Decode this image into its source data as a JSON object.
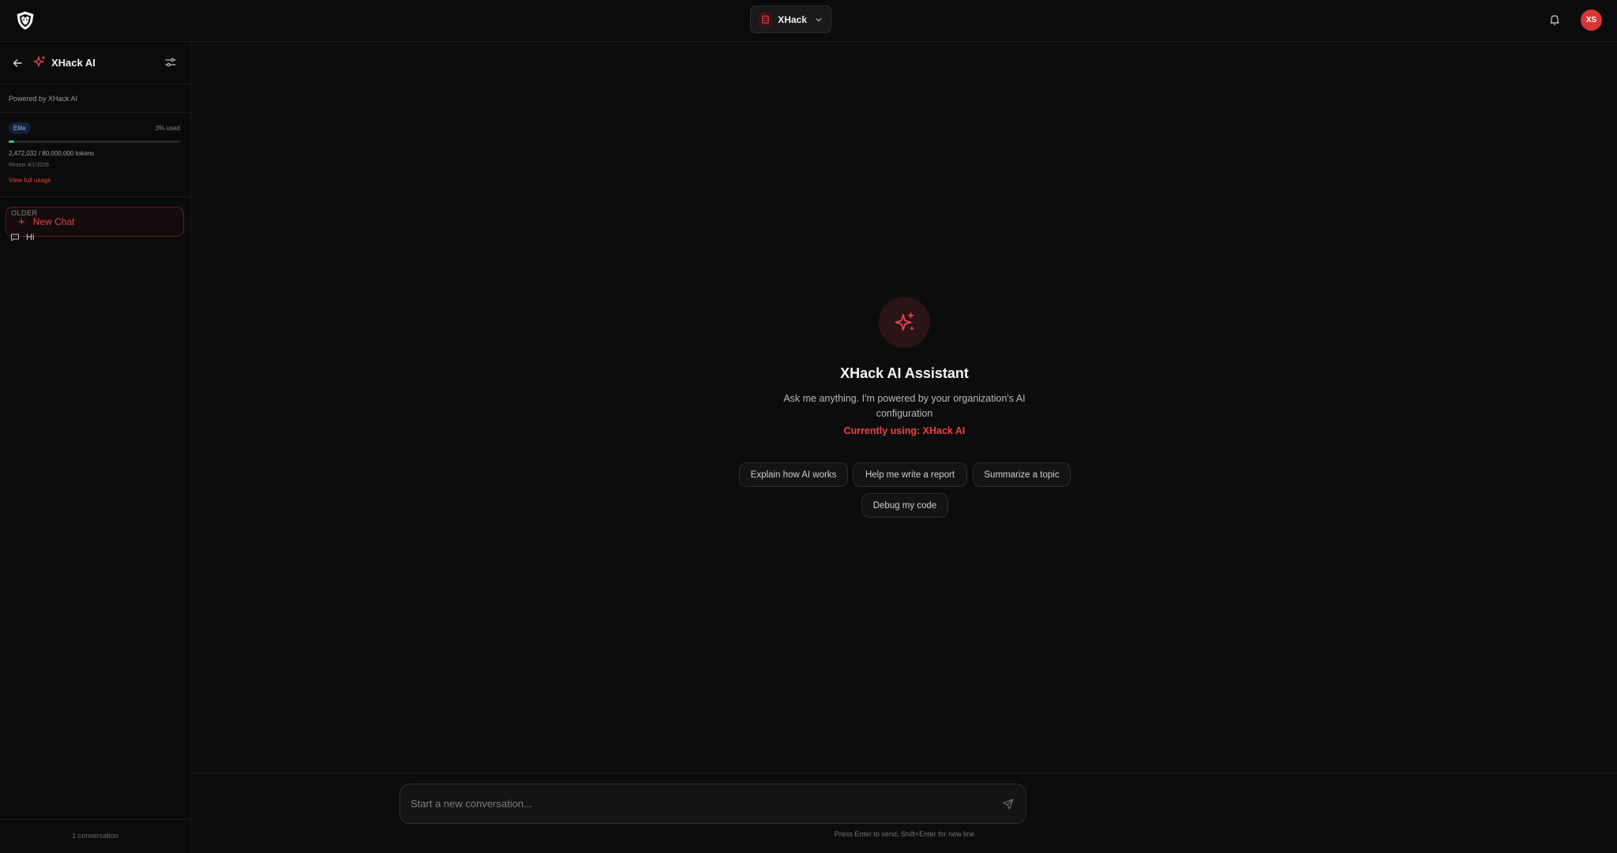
{
  "topbar": {
    "logo_icon": "wolf-shield-logo",
    "org_name": "XHack",
    "org_icon": "building-icon",
    "notifications_icon": "bell-icon",
    "avatar_initials": "XS",
    "avatar_color": "#d93535"
  },
  "sidebar": {
    "back_icon": "arrow-left-icon",
    "title": "XHack AI",
    "title_icon": "sparkle-icon",
    "settings_icon": "sliders-icon",
    "powered_by": "Powered by XHack AI",
    "usage": {
      "plan": "Elite",
      "percent_label": "3% used",
      "percent_value": 3,
      "tokens": "2,472,032 / 80,000,000 tokens",
      "resets": "Resets 4/1/2026",
      "view_link": "View full usage"
    },
    "new_chat_label": "New Chat",
    "group_label": "OLDER",
    "conversations": [
      {
        "title": "Hi",
        "icon": "chat-bubble-icon"
      }
    ],
    "footer": "1 conversation"
  },
  "main": {
    "hero_icon": "sparkle-icon",
    "title": "XHack AI Assistant",
    "subtitle": "Ask me anything. I'm powered by your organization's AI configuration",
    "model_label": "Currently using: XHack AI",
    "suggestions": [
      "Explain how AI works",
      "Help me write a report",
      "Summarize a topic",
      "Debug my code"
    ],
    "composer": {
      "placeholder": "Start a new conversation...",
      "value": "",
      "send_icon": "send-icon",
      "hint": "Press Enter to send, Shift+Enter for new line"
    }
  },
  "colors": {
    "accent": "#e24545",
    "background": "#0b0b0b",
    "usage_bar": "#3fbf7f",
    "badge_bg": "#12203b"
  }
}
